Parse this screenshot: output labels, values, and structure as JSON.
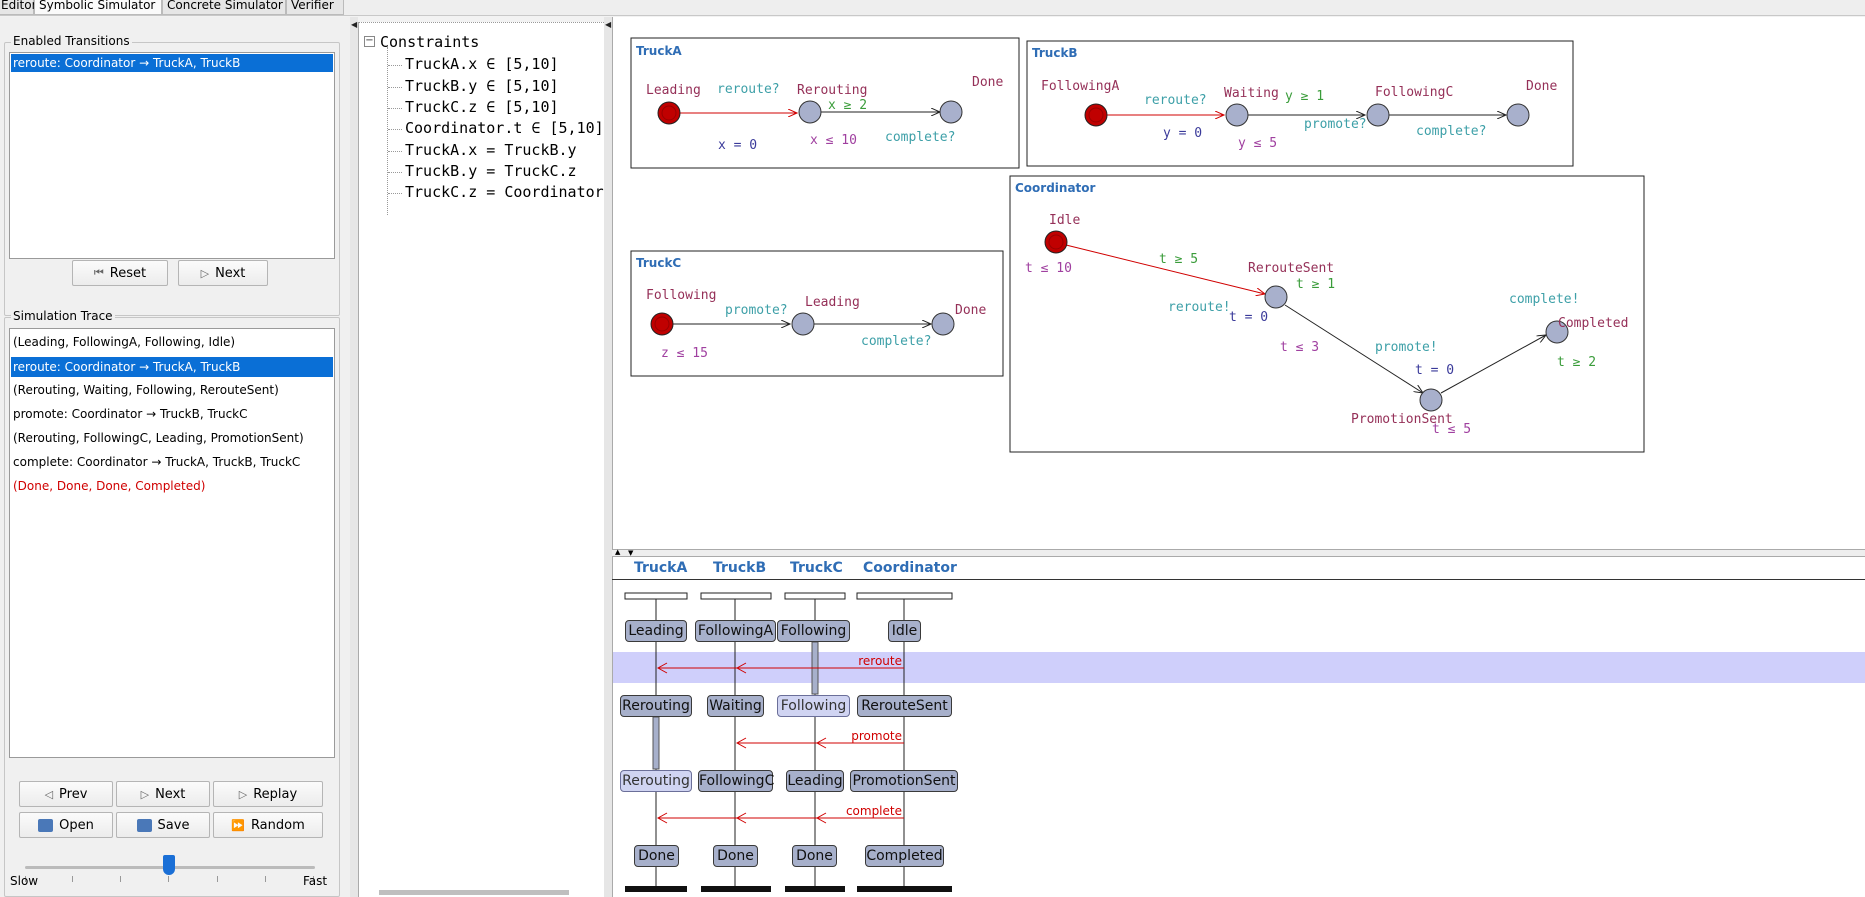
{
  "tabs": [
    "Editor",
    "Symbolic Simulator",
    "Concrete Simulator",
    "Verifier"
  ],
  "enabled_transitions": {
    "title": "Enabled Transitions",
    "items": [
      "reroute: Coordinator → TruckA, TruckB"
    ],
    "reset_label": "Reset",
    "next_label": "Next"
  },
  "simulation_trace": {
    "title": "Simulation Trace",
    "items": [
      "(Leading, FollowingA, Following, Idle)",
      "reroute: Coordinator → TruckA, TruckB",
      "(Rerouting, Waiting, Following, RerouteSent)",
      "promote: Coordinator → TruckB, TruckC",
      "(Rerouting, FollowingC, Leading, PromotionSent)",
      "complete: Coordinator → TruckA, TruckB, TruckC",
      "(Done, Done, Done, Completed)"
    ],
    "selected_index": 1,
    "buttons": {
      "prev": "Prev",
      "next": "Next",
      "replay": "Replay",
      "open": "Open",
      "save": "Save",
      "random": "Random"
    },
    "slider": {
      "slow": "Slow",
      "fast": "Fast",
      "value": 0.4
    }
  },
  "constraints": {
    "root": "Constraints",
    "items": [
      "TruckA.x ∈ [5,10]",
      "TruckB.y ∈ [5,10]",
      "TruckC.z ∈ [5,10]",
      "Coordinator.t ∈ [5,10]",
      "TruckA.x = TruckB.y",
      "TruckB.y = TruckC.z",
      "TruckC.z = Coordinator"
    ]
  },
  "automata": {
    "truckA": {
      "name": "TruckA",
      "locations": [
        "Leading",
        "Rerouting",
        "Done"
      ],
      "labels": {
        "sync1": "reroute?",
        "guard1": "x ≥ 2",
        "update1": "x = 0",
        "inv": "x ≤ 10",
        "sync2": "complete?"
      }
    },
    "truckB": {
      "name": "TruckB",
      "locations": [
        "FollowingA",
        "Waiting",
        "FollowingC",
        "Done"
      ],
      "labels": {
        "sync1": "reroute?",
        "update1": "y = 0",
        "inv": "y ≤ 5",
        "guard2": "y ≥ 1",
        "sync2": "promote?",
        "sync3": "complete?"
      }
    },
    "truckC": {
      "name": "TruckC",
      "locations": [
        "Following",
        "Leading",
        "Done"
      ],
      "labels": {
        "inv": "z ≤ 15",
        "sync1": "promote?",
        "sync2": "complete?"
      }
    },
    "coordinator": {
      "name": "Coordinator",
      "locations": [
        "Idle",
        "RerouteSent",
        "PromotionSent",
        "Completed"
      ],
      "labels": {
        "inv1": "t ≤ 10",
        "guard1": "t ≥ 5",
        "sync1": "reroute!",
        "update1": "t = 0",
        "guard2": "t ≥ 1",
        "inv2": "t ≤ 3",
        "sync2": "promote!",
        "update2": "t = 0",
        "inv3": "t ≤ 5",
        "sync3": "complete!",
        "guard3": "t ≥ 2"
      }
    }
  },
  "msc": {
    "processes": [
      "TruckA",
      "TruckB",
      "TruckC",
      "Coordinator"
    ],
    "states": [
      [
        "Leading",
        "FollowingA",
        "Following",
        "Idle"
      ],
      [
        "Rerouting",
        "Waiting",
        "Following",
        "RerouteSent"
      ],
      [
        "Rerouting",
        "FollowingC",
        "Leading",
        "PromotionSent"
      ],
      [
        "Done",
        "Done",
        "Done",
        "Completed"
      ]
    ],
    "messages": [
      "reroute",
      "promote",
      "complete"
    ]
  },
  "colors": {
    "selection": "#0a6fd6",
    "location_fill": "#a8b0cc",
    "initial_location": "#c00000",
    "edge_red": "#d00000",
    "guard_green": "#3a9c3a",
    "sync_teal": "#3ea0a8",
    "invariant_purple": "#a040a0",
    "update_navy": "#3a3a9a",
    "msc_highlight": "#cfcffb",
    "template_name": "#2f6db5"
  }
}
